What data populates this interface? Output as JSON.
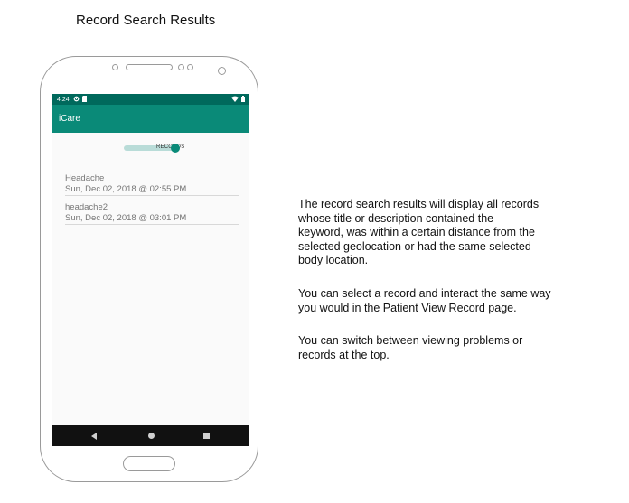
{
  "page": {
    "title": "Record Search Results"
  },
  "status_bar": {
    "time": "4:24"
  },
  "app_bar": {
    "title": "iCare"
  },
  "toggle": {
    "label": "RECORDS"
  },
  "records": [
    {
      "title": "Headache",
      "date": "Sun, Dec 02, 2018 @ 02:55 PM"
    },
    {
      "title": "headache2",
      "date": "Sun, Dec 02, 2018 @ 03:01 PM"
    }
  ],
  "description": {
    "paragraph1_lines": [
      "The record search results will display all records",
      "whose title or description contained the",
      "keyword, was within a certain distance from the",
      "selected geolocation or had the same selected",
      "body location."
    ],
    "paragraph2_lines": [
      "You can select a record and interact the same way",
      "you would in the Patient View Record page."
    ],
    "paragraph3_lines": [
      "You can switch between viewing problems or",
      "records at the top."
    ]
  },
  "colors": {
    "status_bar": "#00695c",
    "app_bar": "#0a8a78",
    "toggle_track": "#b9dcd8"
  },
  "icons": [
    "gear-icon",
    "sd-card-icon",
    "wifi-icon",
    "battery-icon",
    "nav-back-icon",
    "nav-home-icon",
    "nav-recents-icon"
  ]
}
